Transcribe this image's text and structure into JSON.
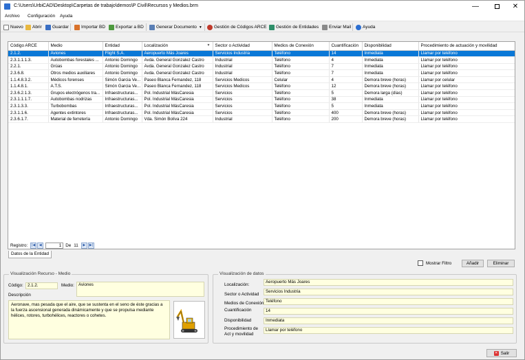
{
  "window": {
    "title": "C:\\Users\\UrbiCAD\\Desktop\\Carpetas de trabajo\\demos\\P Civil\\Recursos y Medios.brm",
    "minimize": "—",
    "close": "✕"
  },
  "menu": [
    "Archivo",
    "Configuración",
    "Ayuda"
  ],
  "toolbar": {
    "nuevo": "Nuevo",
    "abrir": "Abrir",
    "guardar": "Guardar",
    "importar": "Importar BD",
    "exportar": "Exportar a BD",
    "generar": "Generar Documento",
    "gestion_arce": "Gestión de Códigos ARCE",
    "gestion_entidades": "Gestión de Entidades",
    "enviar_mail": "Enviar Mail",
    "ayuda": "Ayuda"
  },
  "grid": {
    "columns": [
      "Código ARCE",
      "Medio",
      "Entidad",
      "Localización",
      "Sector o Actividad",
      "Medios de Conexión",
      "Cuantificación",
      "Disponibilidad",
      "Procedimiento de actuación y movilidad"
    ],
    "rows": [
      [
        "2.1.2.",
        "Aviones",
        "Flight S.A.",
        "Aeropuerto Más Joares",
        "Servicios Industria",
        "Teléfono",
        "14",
        "Inmediata",
        "Llamar por teléfono"
      ],
      [
        "2.3.1.1.1.3.",
        "Autobombas forestales ...",
        "Antonio Domingo",
        "Avda. General Gonzalez Castro",
        "Industrial",
        "Teléfono",
        "4",
        "Inmediata",
        "Llamar por teléfono"
      ],
      [
        "2.2.1.",
        "Grúas",
        "Antonio Domingo",
        "Avda. General Gonzalez Castro",
        "Industrial",
        "Teléfono",
        "7",
        "Inmediata",
        "Llamar por teléfono"
      ],
      [
        "2.3.6.8.",
        "Otros medios auxiliares",
        "Antonio Domingo",
        "Avda. General Gonzalez Castro",
        "Industrial",
        "Teléfono",
        "7",
        "Inmediata",
        "Llamar por teléfono"
      ],
      [
        "1.1.4.8.3.2.",
        "Médicos forenses",
        "Simón Garcia Ve...",
        "Paseo Blanca Fernandez, 118",
        "Servicios Medicos",
        "Celular",
        "4",
        "Demora breve (horas)",
        "Llamar por celular"
      ],
      [
        "1.1.4.8.1.",
        "A.T.S.",
        "Simón Garcia Ve...",
        "Paseo Blanca Fernandez, 118",
        "Servicios Medicos",
        "Teléfono",
        "12",
        "Demora breve (horas)",
        "Llamar por teléfono"
      ],
      [
        "2.3.6.2.1.3.",
        "Grupos electrógenos tra...",
        "Infraestructuras...",
        "Pol. Industrial MásCaresia",
        "Servicios",
        "Teléfono",
        "5",
        "Demora larga (días)",
        "Llamar por teléfono"
      ],
      [
        "2.3.1.1.1.7.",
        "Autobombas nodrizas",
        "Infraestructuras...",
        "Pol. Industrial MásCaresia",
        "Servicios",
        "Teléfono",
        "38",
        "Inmediata",
        "Llamar por teléfono"
      ],
      [
        "2.3.1.3.3.",
        "Turbobombas",
        "Infraestructuras...",
        "Pol. Industrial MásCaresia",
        "Servicios",
        "Teléfono",
        "5",
        "Inmediata",
        "Llamar por teléfono"
      ],
      [
        "2.3.1.1.6.",
        "Agentes extintores",
        "Infraestructuras...",
        "Pol. Industrial MásCaresia",
        "Servicios",
        "Teléfono",
        "400",
        "Demora breve (horas)",
        "Llamar por teléfono"
      ],
      [
        "2.3.6.1.7.",
        "Material de ferretería",
        "Antonio Domingo",
        "Vda. Simón Bolíva 224",
        "Industrial",
        "Teléfono",
        "200",
        "Demora breve (horas)",
        "Llamar por teléfono"
      ]
    ],
    "selected_row": 0
  },
  "navigator": {
    "label": "Registro:",
    "current": "1",
    "of_label": "De",
    "total": "11"
  },
  "tab_entity": "Datos de la Entidad",
  "filter": {
    "label": "Mostrar Filtro",
    "checked": false
  },
  "buttons": {
    "add": "Añadir",
    "delete": "Eliminar",
    "exit": "Salir"
  },
  "resource_panel": {
    "legend": "Visualización Recurso - Medio",
    "code_label": "Código:",
    "code_value": "2.1.2.",
    "medio_label": "Medio:",
    "medio_value": "Aviones",
    "desc_label": "Descripción",
    "desc_value": "Aeronave, mas pesada que el aire, que se sustenta en el seno de éste gracias a la fuerza ascensional generada dinámicamente y que se propulsa mediante hélices, rotores, turbohélices, reactores o cohetes.",
    "image_icon": "excavator-icon"
  },
  "data_panel": {
    "legend": "Visualización de datos",
    "fields": [
      {
        "label": "Localización:",
        "value": "Aeropuerto Más Joares"
      },
      {
        "label": "Sector o Actividad",
        "value": "Servicios Industria"
      },
      {
        "label": "Medios de Conexión",
        "value": "Teléfono"
      },
      {
        "label": "Cuantificación",
        "value": "14"
      },
      {
        "label": "Disponibilidad",
        "value": "Inmediata"
      },
      {
        "label": "Procedimiento de Act y movilidad",
        "value": "Llamar por teléfono"
      }
    ]
  },
  "colors": {
    "selection": "#0a78d7",
    "field_bg": "#ffffe0"
  }
}
